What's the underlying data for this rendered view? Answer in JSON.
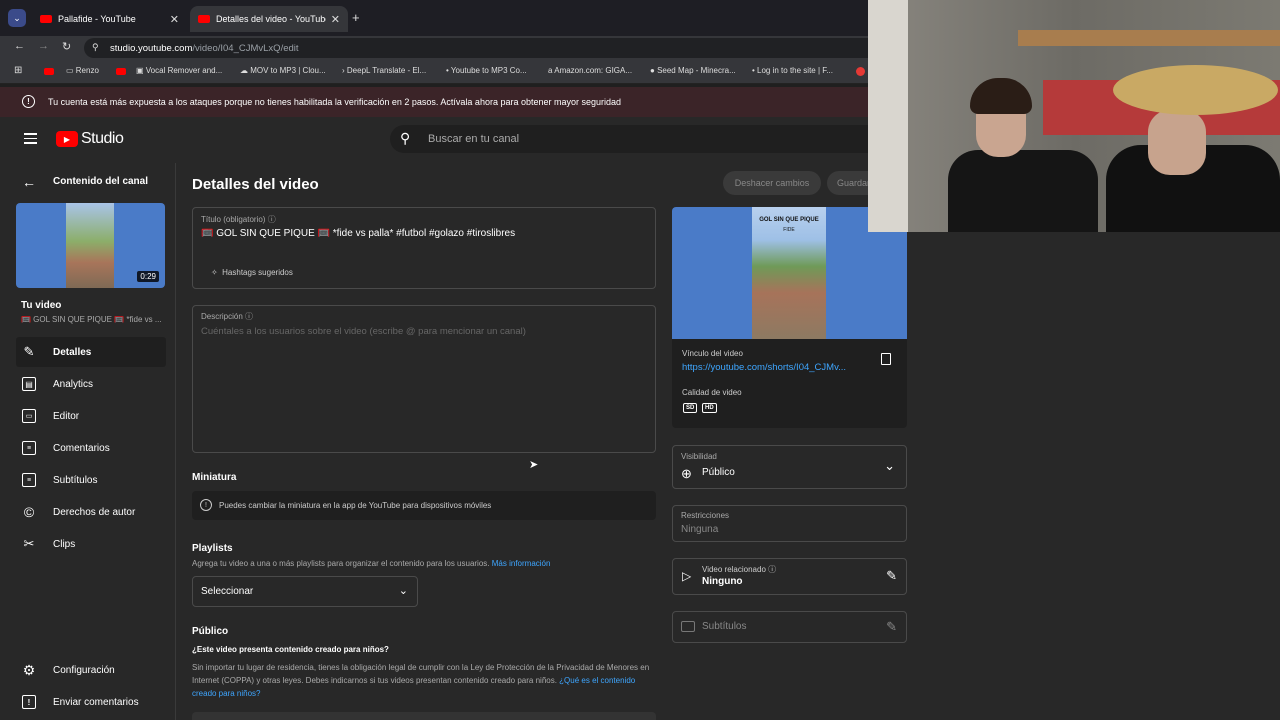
{
  "browser": {
    "tabs": [
      {
        "label": "Pallafide - YouTube"
      },
      {
        "label": "Detalles del video - YouTube Stu"
      }
    ],
    "url_host": "studio.youtube.com",
    "url_path": "/video/I04_CJMvLxQ/edit",
    "bookmarks": [
      "Renzo",
      "Vocal Remover and...",
      "MOV to MP3 | Clou...",
      "DeepL Translate - El...",
      "Youtube to MP3 Co...",
      "Amazon.com: GIGA...",
      "Seed Map - Minecra...",
      "Log in to the site | F..."
    ]
  },
  "warning": "Tu cuenta está más expuesta a los ataques porque no tienes habilitada la verificación en 2 pasos. Actívala ahora para obtener mayor seguridad",
  "header": {
    "logo": "Studio",
    "search_placeholder": "Buscar en tu canal"
  },
  "sidebar": {
    "back_label": "Contenido del canal",
    "duration": "0:29",
    "your_video": "Tu video",
    "video_title_short": "🥅 GOL SIN QUE PIQUE 🥅 *fide vs ...",
    "items": [
      {
        "label": "Detalles",
        "icon": "pencil-icon"
      },
      {
        "label": "Analytics",
        "icon": "analytics-icon"
      },
      {
        "label": "Editor",
        "icon": "film-icon"
      },
      {
        "label": "Comentarios",
        "icon": "comment-icon"
      },
      {
        "label": "Subtítulos",
        "icon": "subtitles-icon"
      },
      {
        "label": "Derechos de autor",
        "icon": "copyright-icon"
      },
      {
        "label": "Clips",
        "icon": "scissors-icon"
      }
    ],
    "settings": "Configuración",
    "feedback": "Enviar comentarios"
  },
  "main": {
    "page_title": "Detalles del video",
    "undo": "Deshacer cambios",
    "save": "Guardar",
    "title_label": "Título (obligatorio)",
    "title_value": "🥅 GOL SIN QUE PIQUE 🥅 *fide vs palla* #futbol #golazo #tiroslibres",
    "hashtags": "Hashtags sugeridos",
    "desc_label": "Descripción",
    "desc_placeholder": "Cuéntales a los usuarios sobre el video (escribe @ para mencionar un canal)",
    "thumb_section": "Miniatura",
    "thumb_info": "Puedes cambiar la miniatura en la app de YouTube para dispositivos móviles",
    "playlists_section": "Playlists",
    "playlists_desc": "Agrega tu video a una o más playlists para organizar el contenido para los usuarios.",
    "more_info": "Más información",
    "select": "Seleccionar",
    "audience_section": "Público",
    "audience_question": "¿Este video presenta contenido creado para niños?",
    "audience_desc": "Sin importar tu lugar de residencia, tienes la obligación legal de cumplir con la Ley de Protección de la Privacidad de Menores en Internet (COPPA) y otras leyes. Debes indicarnos si tus videos presentan contenido creado para niños.",
    "audience_link": "¿Qué es el contenido creado para niños?"
  },
  "right": {
    "preview_caption": "GOL SIN QUE PIQUE",
    "preview_sub": "FIDE",
    "link_label": "Vínculo del video",
    "link_value": "https://youtube.com/shorts/I04_CJMv...",
    "quality_label": "Calidad de video",
    "quality_sd": "SD",
    "quality_hd": "HD",
    "visibility_label": "Visibilidad",
    "visibility_value": "Público",
    "restrictions_label": "Restricciones",
    "restrictions_value": "Ninguna",
    "related_label": "Video relacionado",
    "related_value": "Ninguno",
    "subtitles": "Subtítulos"
  },
  "colors": {
    "accent": "#3ea6ff",
    "brand": "#ff0000",
    "warning_bg": "#3b2428"
  }
}
